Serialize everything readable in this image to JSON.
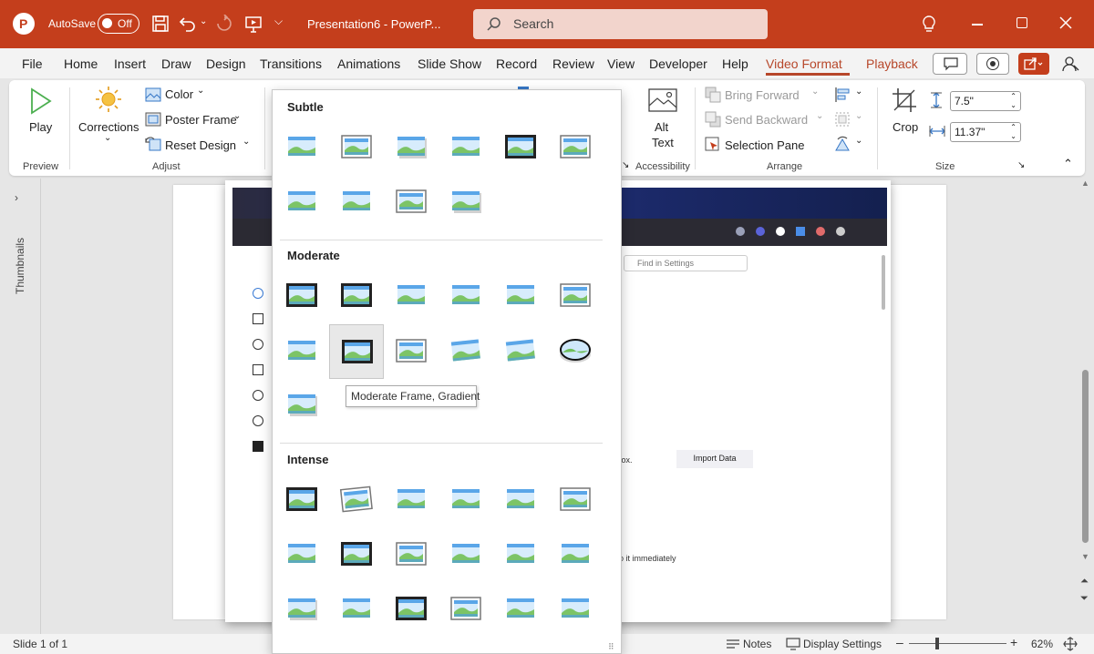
{
  "titlebar": {
    "autosave_label": "AutoSave",
    "autosave_state": "Off",
    "doc_title": "Presentation6 - PowerP...",
    "search_placeholder": "Search"
  },
  "menu": {
    "tabs": [
      "File",
      "Home",
      "Insert",
      "Draw",
      "Design",
      "Transitions",
      "Animations",
      "Slide Show",
      "Record",
      "Review",
      "View",
      "Developer",
      "Help",
      "Video Format",
      "Playback"
    ],
    "active_tab": "Video Format"
  },
  "ribbon": {
    "play": "Play",
    "corrections": "Corrections",
    "color": "Color",
    "poster_frame": "Poster Frame",
    "reset_design": "Reset Design",
    "preview_group": "Preview",
    "adjust_group": "Adjust",
    "alt_text_1": "Alt",
    "alt_text_2": "Text",
    "accessibility_group": "Accessibility",
    "bring_forward": "Bring Forward",
    "send_backward": "Send Backward",
    "selection_pane": "Selection Pane",
    "arrange_group": "Arrange",
    "crop": "Crop",
    "height_value": "7.5\"",
    "width_value": "11.37\"",
    "size_group": "Size"
  },
  "side": {
    "thumbnails": "Thumbnails"
  },
  "video": {
    "find_placeholder": "Find in Settings",
    "import_data": "Import Data",
    "text_ox": "fox.",
    "text_immediately": "o it immediately"
  },
  "gallery": {
    "subtle": "Subtle",
    "moderate": "Moderate",
    "intense": "Intense",
    "tooltip": "Moderate Frame, Gradient"
  },
  "status": {
    "slide_info": "Slide 1 of 1",
    "notes": "Notes",
    "display_settings": "Display Settings",
    "zoom": "62%"
  },
  "colors": {
    "accent": "#c43e1c",
    "active_tab": "#b7472a"
  }
}
